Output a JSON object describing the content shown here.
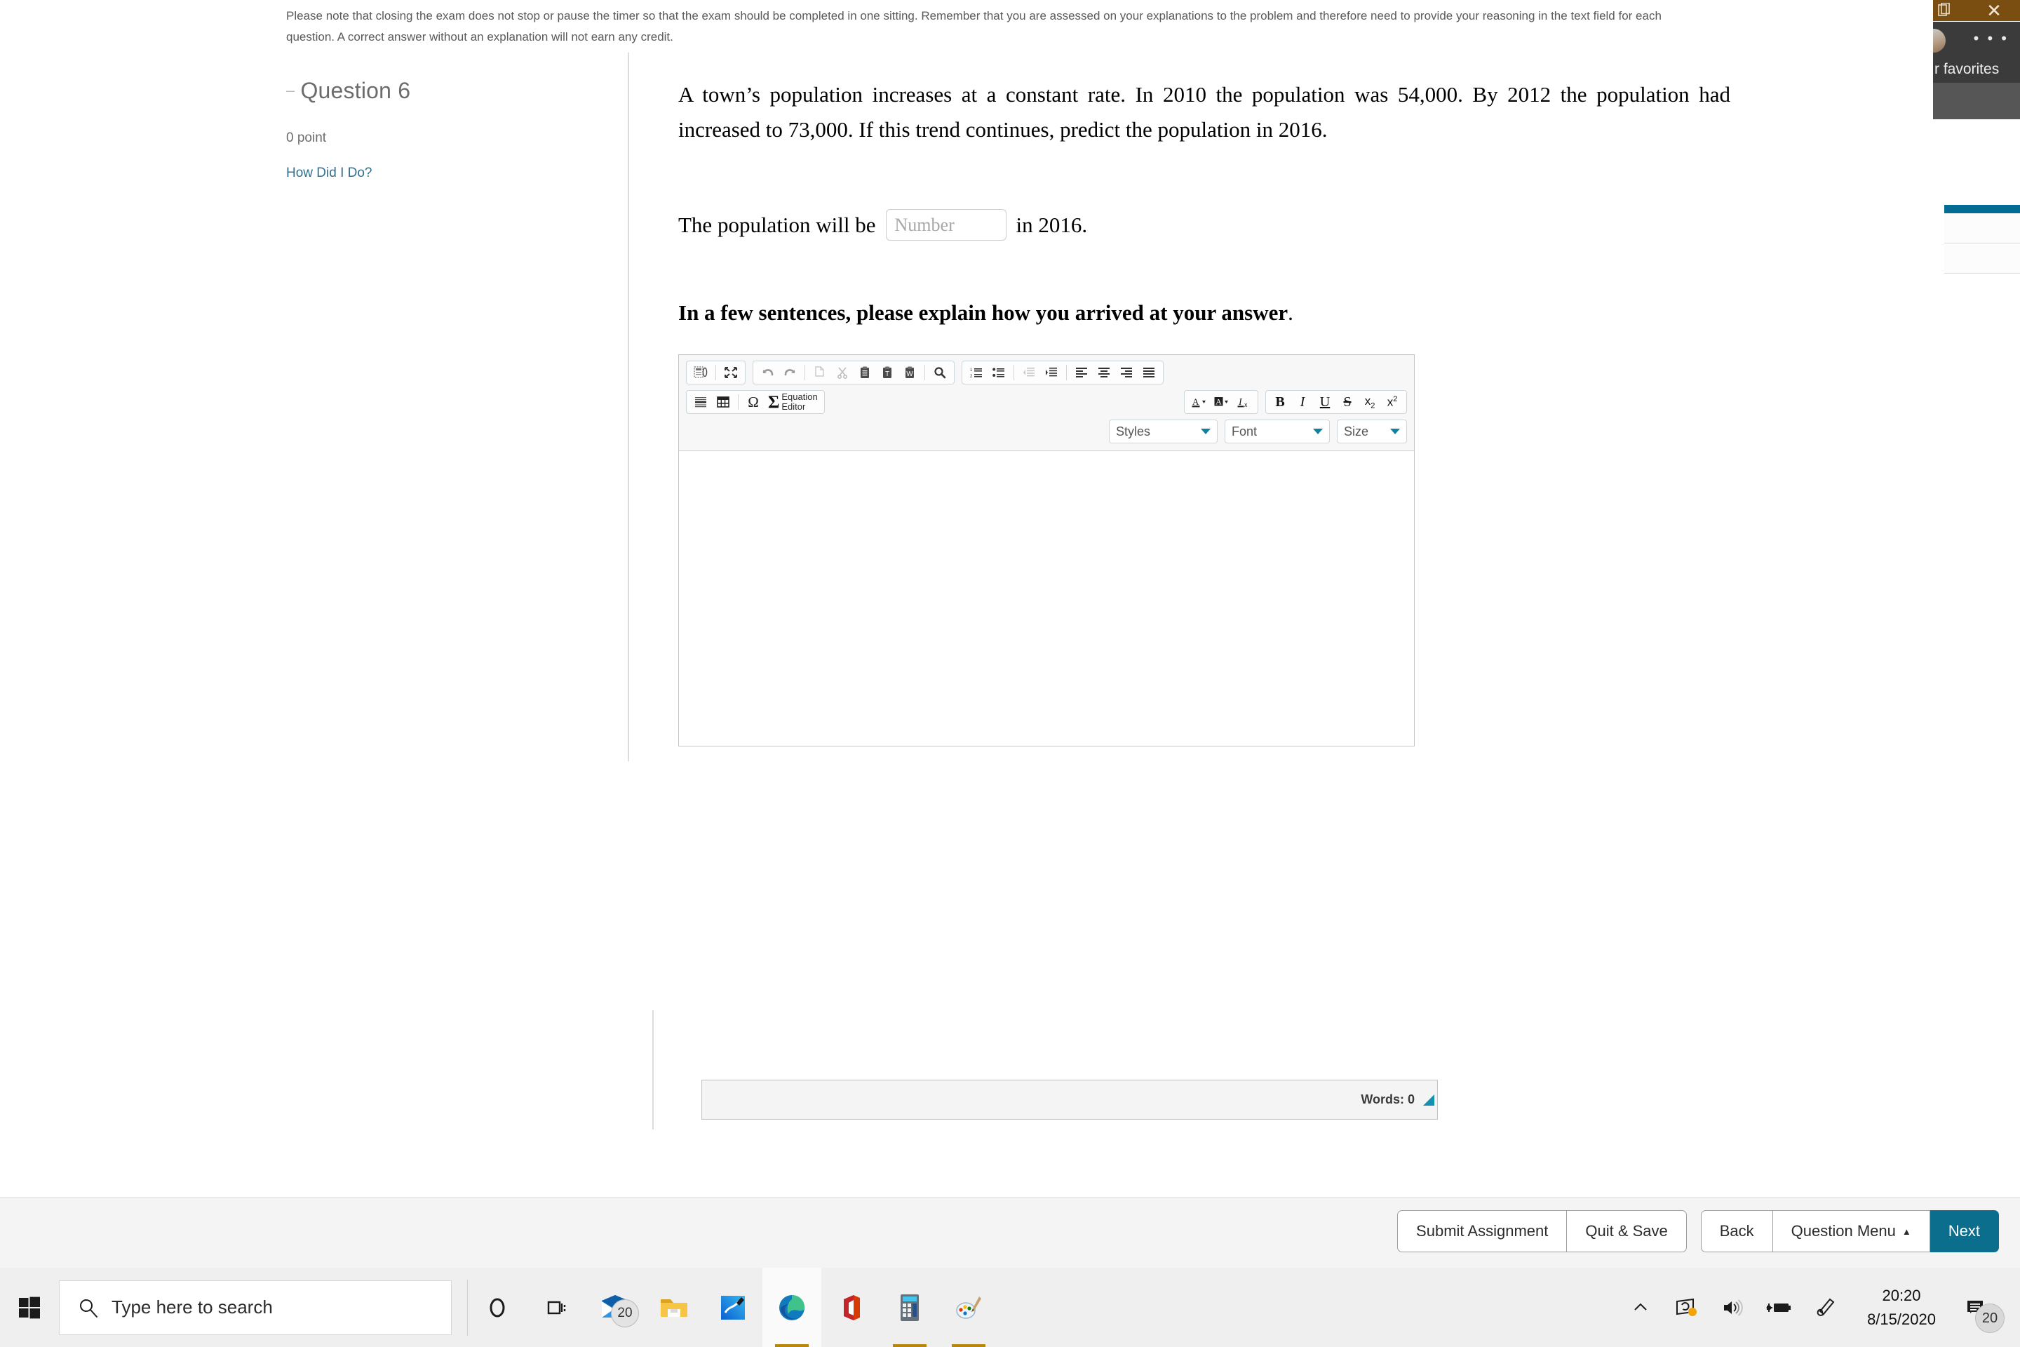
{
  "window": {
    "chrome_accent": "#7a4e11",
    "close_label": "✕"
  },
  "instructions": {
    "text": "Please note that closing the exam does not stop or pause the timer so that the exam should be completed in one sitting. Remember that you are assessed on your explanations to the problem and therefore need to provide your reasoning in the text field for each question. A correct answer without an explanation will not earn any credit."
  },
  "question_rail": {
    "collapse_glyph": "–",
    "title": "Question 6",
    "points": "0 point",
    "how_did_i_do": "How Did I Do?"
  },
  "question": {
    "stem": "A town’s population increases at a constant rate. In 2010 the population was 54,000. By 2012 the population had increased to 73,000. If this trend continues, predict the population in 2016.",
    "answer_prefix": "The population will be",
    "answer_suffix": "in 2016.",
    "number_placeholder": "Number",
    "number_value": "",
    "explain_prompt": "In a few sentences, please explain how you arrived at your answer",
    "explain_prompt_period": "."
  },
  "editor": {
    "toolbar_row1": [
      {
        "name": "templates-icon",
        "title": "Templates"
      },
      {
        "name": "maximize-icon",
        "title": "Maximize"
      },
      {
        "name": "undo-icon",
        "title": "Undo"
      },
      {
        "name": "redo-icon",
        "title": "Redo"
      },
      {
        "name": "copy-icon",
        "title": "Copy"
      },
      {
        "name": "cut-icon",
        "title": "Cut"
      },
      {
        "name": "paste-icon",
        "title": "Paste"
      },
      {
        "name": "paste-as-text-icon",
        "title": "Paste as plain text"
      },
      {
        "name": "paste-from-word-icon",
        "title": "Paste from Word"
      },
      {
        "name": "find-icon",
        "title": "Find"
      },
      {
        "name": "numbered-list-icon",
        "title": "Insert/Remove Numbered List"
      },
      {
        "name": "bulleted-list-icon",
        "title": "Insert/Remove Bulleted List"
      },
      {
        "name": "outdent-icon",
        "title": "Decrease Indent"
      },
      {
        "name": "indent-icon",
        "title": "Increase Indent"
      },
      {
        "name": "align-left-icon",
        "title": "Align Left"
      },
      {
        "name": "align-center-icon",
        "title": "Center"
      },
      {
        "name": "align-right-icon",
        "title": "Align Right"
      },
      {
        "name": "align-justify-icon",
        "title": "Justify"
      }
    ],
    "toolbar_row2": [
      {
        "name": "horizontal-rule-icon",
        "title": "Insert Horizontal Line"
      },
      {
        "name": "table-icon",
        "title": "Table"
      },
      {
        "name": "special-character-icon",
        "title": "Insert Special Character",
        "glyph": "Ω"
      },
      {
        "name": "sigma-icon",
        "title": "Equation Editor",
        "glyph": "Σ"
      },
      {
        "name": "text-color-icon",
        "title": "Text Color",
        "glyph": "A"
      },
      {
        "name": "background-color-icon",
        "title": "Background Color",
        "glyph": "A"
      },
      {
        "name": "remove-format-icon",
        "title": "Remove Format"
      },
      {
        "name": "bold-icon",
        "title": "Bold",
        "glyph": "B"
      },
      {
        "name": "italic-icon",
        "title": "Italic",
        "glyph": "I"
      },
      {
        "name": "underline-icon",
        "title": "Underline",
        "glyph": "U"
      },
      {
        "name": "strikethrough-icon",
        "title": "Strike Through",
        "glyph": "S"
      },
      {
        "name": "subscript-icon",
        "title": "Subscript"
      },
      {
        "name": "superscript-icon",
        "title": "Superscript"
      }
    ],
    "equation_editor_label_line1": "Equation",
    "equation_editor_label_line2": "Editor",
    "selects": {
      "styles": "Styles",
      "font": "Font",
      "size": "Size"
    },
    "body_text": "",
    "status": {
      "word_count_label": "Words: 0",
      "resize_grip_color": "#1590b0"
    }
  },
  "action_bar": {
    "submit_assignment": "Submit Assignment",
    "quit_and_save": "Quit & Save",
    "back": "Back",
    "question_menu": "Question Menu",
    "question_menu_caret": "▲",
    "next": "Next",
    "next_color": "#0a6e8c"
  },
  "right_panel": {
    "favorites_text": "r favorites",
    "dots": "• • •"
  },
  "taskbar": {
    "search_placeholder": "Type here to search",
    "apps": [
      {
        "name": "cortana-icon",
        "label": "Cortana"
      },
      {
        "name": "task-view-icon",
        "label": "Task View"
      },
      {
        "name": "mail-icon",
        "label": "Mail",
        "badge": "20"
      },
      {
        "name": "file-explorer-icon",
        "label": "File Explorer"
      },
      {
        "name": "onenote-icon",
        "label": "OneNote"
      },
      {
        "name": "edge-icon",
        "label": "Microsoft Edge",
        "active": true
      },
      {
        "name": "office-icon",
        "label": "Office"
      },
      {
        "name": "calculator-icon",
        "label": "Calculator"
      },
      {
        "name": "paint-icon",
        "label": "Paint"
      }
    ],
    "tray": [
      {
        "name": "show-hidden-icons-chevron-icon"
      },
      {
        "name": "onedrive-sync-icon"
      },
      {
        "name": "volume-icon"
      },
      {
        "name": "battery-charging-icon"
      },
      {
        "name": "pen-workspace-icon"
      }
    ],
    "clock_time": "20:20",
    "clock_date": "8/15/2020",
    "notifications_badge": "20"
  }
}
